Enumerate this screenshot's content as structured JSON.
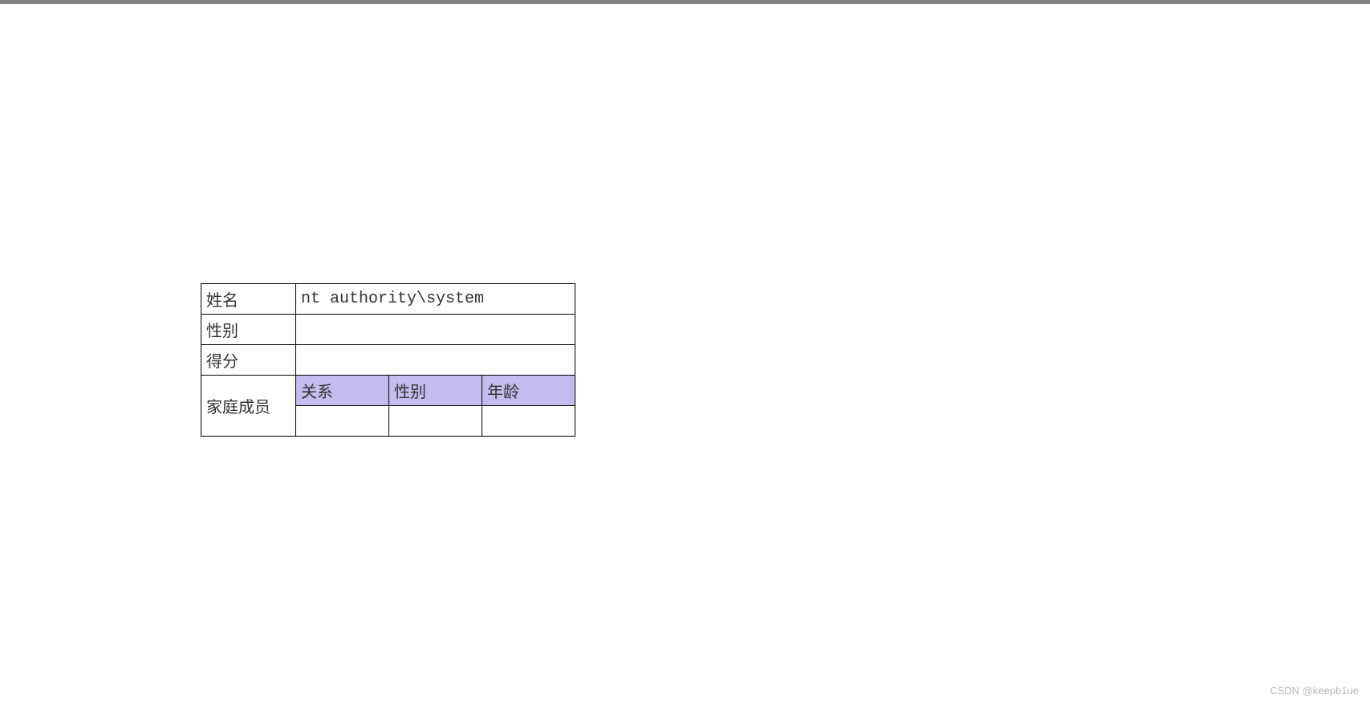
{
  "table": {
    "name_label": "姓名",
    "name_value": "nt  authority\\system",
    "gender_label": "性别",
    "gender_value": "",
    "score_label": "得分",
    "score_value": "",
    "family_label": "家庭成员",
    "family_headers": {
      "relation": "关系",
      "gender": "性别",
      "age": "年龄"
    },
    "family_row": {
      "relation": "",
      "gender": "",
      "age": ""
    }
  },
  "watermark": "CSDN @keepb1ue"
}
